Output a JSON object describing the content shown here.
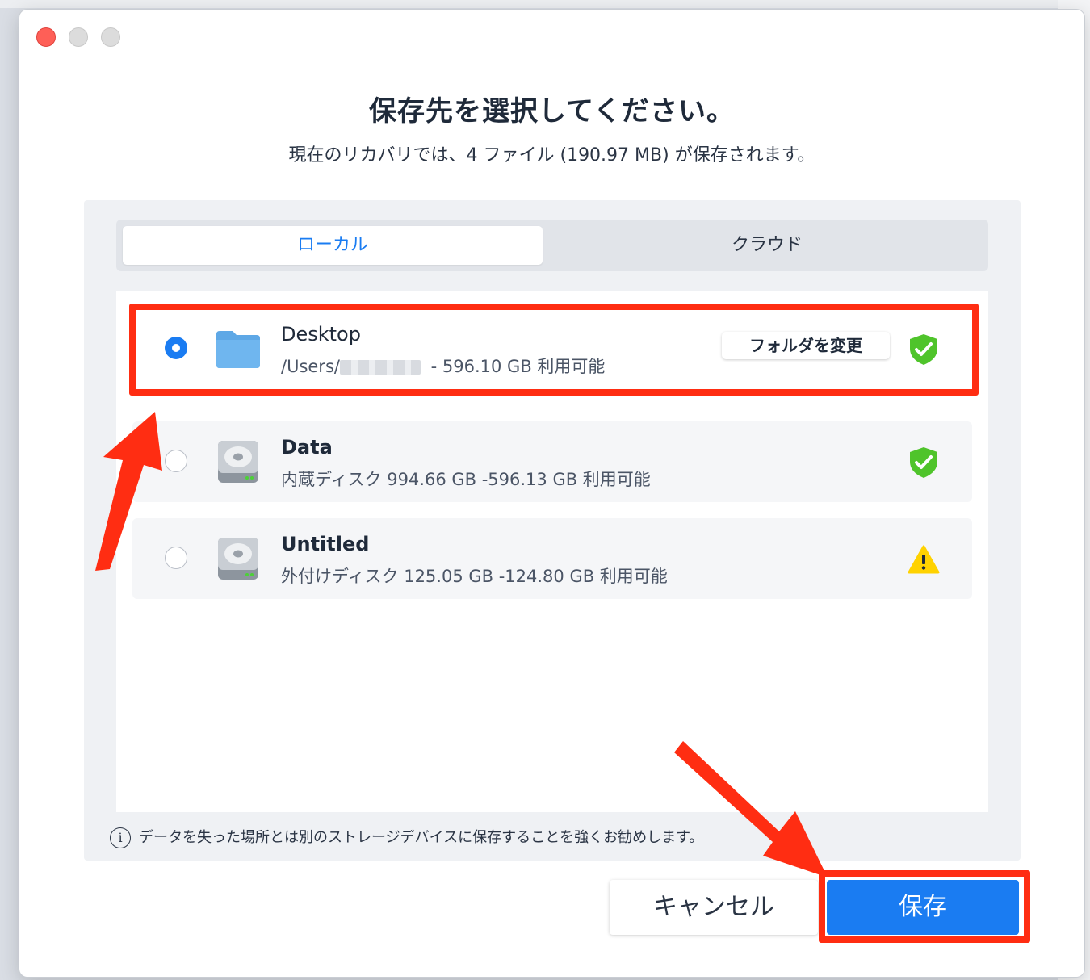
{
  "dialog": {
    "title": "保存先を選択してください。",
    "subtitle": "現在のリカバリでは、4 ファイル (190.97 MB) が保存されます。"
  },
  "tabs": [
    {
      "label": "ローカル",
      "selected": true
    },
    {
      "label": "クラウド",
      "selected": false
    }
  ],
  "destinations": [
    {
      "name": "Desktop",
      "path_prefix": "/Users/",
      "path_suffix": " - 596.10 GB 利用可能",
      "icon": "folder-icon",
      "status": "shield-check-icon",
      "selected": true,
      "action_label": "フォルダを変更"
    },
    {
      "name": "Data",
      "detail": "内蔵ディスク 994.66 GB -596.13 GB 利用可能",
      "icon": "hard-drive-icon",
      "status": "shield-check-icon",
      "selected": false
    },
    {
      "name": "Untitled",
      "detail": "外付けディスク 125.05 GB -124.80 GB 利用可能",
      "icon": "hard-drive-icon",
      "status": "warning-icon",
      "selected": false
    }
  ],
  "note": {
    "icon": "info-icon",
    "text": "データを失った場所とは別のストレージデバイスに保存することを強くお勧めします。"
  },
  "buttons": {
    "cancel": "キャンセル",
    "save": "保存"
  },
  "colors": {
    "accent": "#1a7cf2",
    "annotation_red": "#ff2d12",
    "shield_green": "#4fc42b",
    "warning_yellow": "#ffd200"
  }
}
